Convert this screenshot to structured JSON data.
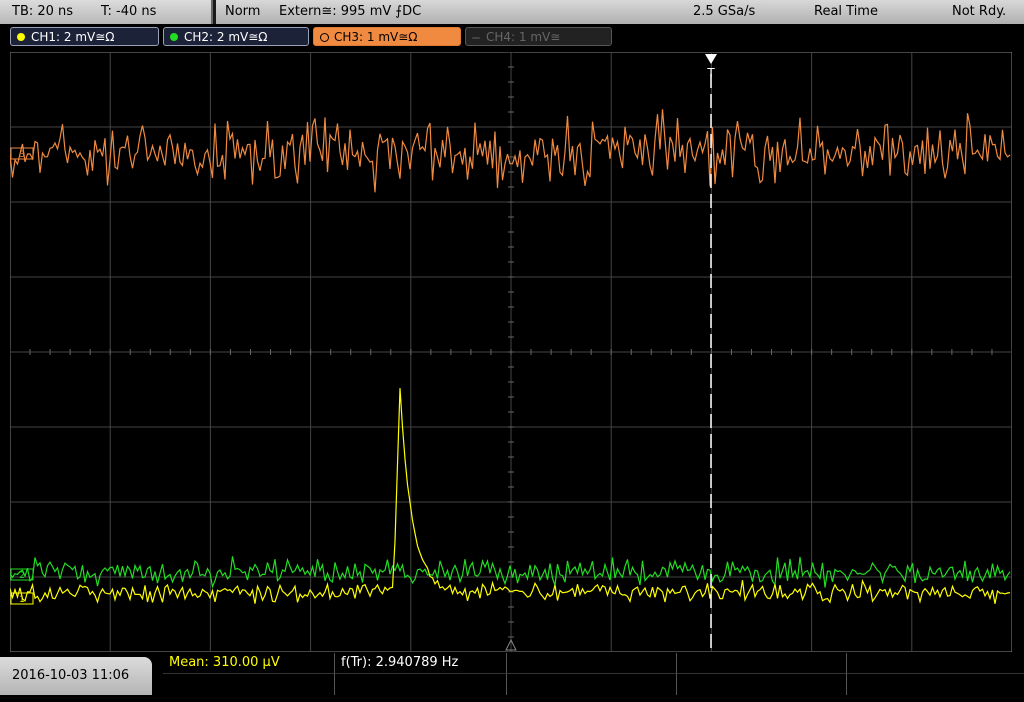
{
  "header": {
    "timebase": "TB: 20 ns",
    "trigger_time": "T: -40 ns",
    "trigger_mode": "Norm",
    "trigger_source": "Extern≅: 995 mV ⨍DC",
    "sample_rate": "2.5 GSa/s",
    "acq_mode": "Real Time",
    "status": "Not Rdy."
  },
  "channels": [
    {
      "label": "CH1: 2 mV≅Ω",
      "color": "#ffff00"
    },
    {
      "label": "CH2: 2 mV≅Ω",
      "color": "#22dd22"
    },
    {
      "label": "CH3: 1 mV≅Ω",
      "color": "#f08a40"
    },
    {
      "label": "CH4: 1 mV≅",
      "color": "#555555"
    }
  ],
  "markers": {
    "ch3": "3",
    "ch2": "2",
    "ch1": "1",
    "trigger": "T"
  },
  "measurements": {
    "mean": "Mean: 310.00 µV",
    "freq": "f(Tr): 2.940789 Hz"
  },
  "datetime": "2016-10-03 11:06",
  "colors": {
    "ch3_trace": "#f08a40",
    "ch2_trace": "#22dd22",
    "ch1_trace": "#ffff00",
    "grid": "#444444"
  }
}
